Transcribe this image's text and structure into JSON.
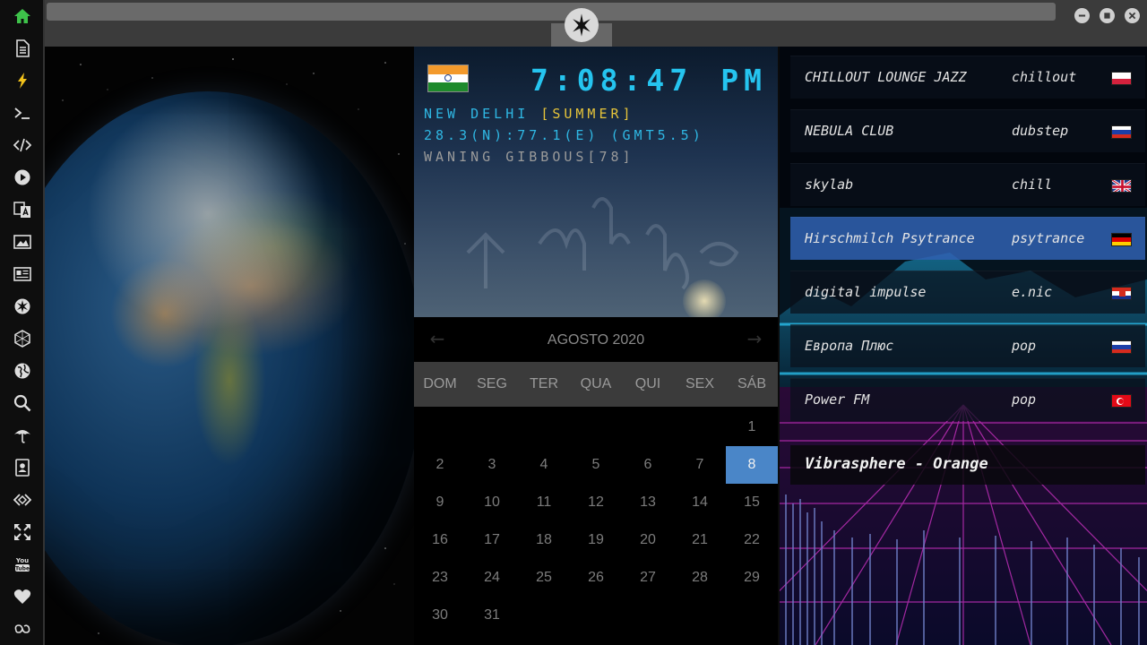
{
  "sidebar": {
    "icons": [
      "home-icon",
      "document-icon",
      "lightning-icon",
      "terminal-icon",
      "code-icon",
      "play-icon",
      "translate-icon",
      "image-icon",
      "news-icon",
      "rebel-alliance-icon",
      "hexagon-icon",
      "globe-icon",
      "search-icon",
      "umbrella-icon",
      "contacts-icon",
      "tag-code-icon",
      "expand-arrows-icon",
      "youtube-icon",
      "heart-icon",
      "infinity-cloud-icon"
    ],
    "active_color": "#3ec24a"
  },
  "clock": {
    "time": "7:08:47",
    "ampm": "PM",
    "city": "NEW DELHI",
    "season": "[SUMMER]",
    "coords": "28.3(N):77.1(E) (GMT5.5)",
    "moon": "WANING GIBBOUS[78]",
    "time_color": "#25c4ef",
    "season_color": "#e6c43a"
  },
  "calendar": {
    "prev": "←",
    "next": "→",
    "title": "AGOSTO 2020",
    "weekdays": [
      "DOM",
      "SEG",
      "TER",
      "QUA",
      "QUI",
      "SEX",
      "SÁB"
    ],
    "weeks": [
      [
        "",
        "",
        "",
        "",
        "",
        "",
        "1"
      ],
      [
        "2",
        "3",
        "4",
        "5",
        "6",
        "7",
        "8"
      ],
      [
        "9",
        "10",
        "11",
        "12",
        "13",
        "14",
        "15"
      ],
      [
        "16",
        "17",
        "18",
        "19",
        "20",
        "21",
        "22"
      ],
      [
        "23",
        "24",
        "25",
        "26",
        "27",
        "28",
        "29"
      ],
      [
        "30",
        "31",
        "",
        "",
        "",
        "",
        ""
      ]
    ],
    "selected": "8",
    "selected_color": "#4a86c8"
  },
  "radio": {
    "stations": [
      {
        "name": "CHILLOUT LOUNGE JAZZ",
        "genre": "chillout",
        "flag": "poland",
        "active": false
      },
      {
        "name": "NEBULA CLUB",
        "genre": "dubstep",
        "flag": "russia",
        "active": false
      },
      {
        "name": "skylab",
        "genre": "chill",
        "flag": "united-kingdom",
        "active": false
      },
      {
        "name": "Hirschmilch Psytrance",
        "genre": "psytrance",
        "flag": "germany",
        "active": true
      },
      {
        "name": "digital impulse",
        "genre": "e.nic",
        "flag": "croatia",
        "active": false
      },
      {
        "name": "Европа Плюс",
        "genre": "pop",
        "flag": "russia",
        "active": false
      },
      {
        "name": "Power FM",
        "genre": "pop",
        "flag": "turkey",
        "active": false
      }
    ],
    "now_playing": "Vibrasphere - Orange",
    "active_color": "#3060b2"
  }
}
